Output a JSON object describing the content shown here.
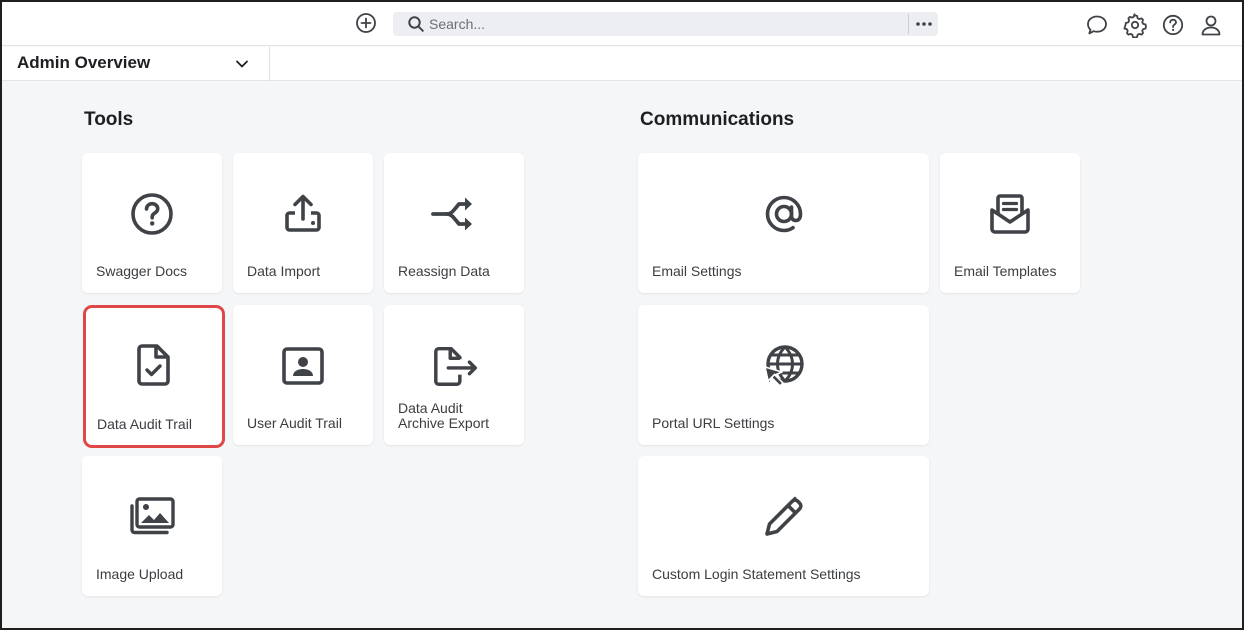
{
  "topbar": {
    "search_placeholder": "Search...",
    "icons": [
      "add-circle-icon",
      "search-icon",
      "more-horizontal-icon",
      "chat-icon",
      "gear-icon",
      "help-icon",
      "user-icon"
    ]
  },
  "view_selector": {
    "label": "Admin Overview"
  },
  "sections": {
    "tools": {
      "title": "Tools",
      "tiles": [
        {
          "label": "Swagger Docs",
          "icon": "question-circle-icon"
        },
        {
          "label": "Data Import",
          "icon": "upload-icon"
        },
        {
          "label": "Reassign Data",
          "icon": "split-arrows-icon"
        },
        {
          "label": "Data Audit Trail",
          "icon": "file-check-icon",
          "highlighted": true
        },
        {
          "label": "User Audit Trail",
          "icon": "user-card-icon"
        },
        {
          "label_line1": "Data Audit",
          "label_line2": "Archive Export",
          "icon": "file-export-icon"
        },
        {
          "label": "Image Upload",
          "icon": "images-icon"
        }
      ]
    },
    "communications": {
      "title": "Communications",
      "tiles": [
        {
          "label": "Email Settings",
          "icon": "at-sign-icon"
        },
        {
          "label": "Email Templates",
          "icon": "envelope-open-icon"
        },
        {
          "label": "Portal URL Settings",
          "icon": "globe-cursor-icon"
        },
        {
          "label": "Custom Login Statement Settings",
          "icon": "pen-icon"
        }
      ]
    }
  },
  "colors": {
    "highlight": "#e04848",
    "icon": "#3f4247",
    "background": "#f5f6f8"
  }
}
